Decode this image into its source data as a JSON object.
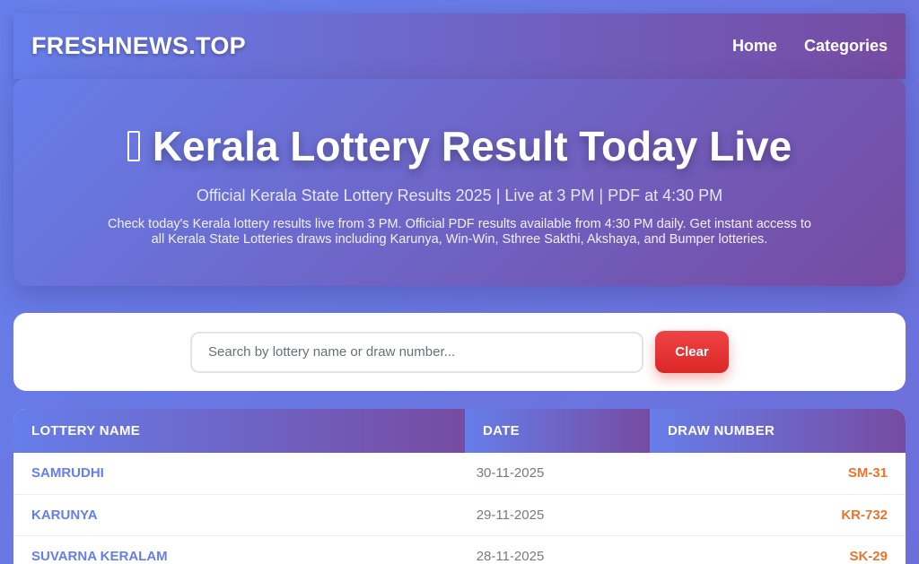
{
  "header": {
    "brand": "FRESHNEWS.TOP",
    "nav": [
      {
        "label": "Home"
      },
      {
        "label": "Categories"
      }
    ]
  },
  "hero": {
    "icon": "box-placeholder-icon",
    "title": "Kerala Lottery Result Today Live",
    "subtitle": "Official Kerala State Lottery Results 2025 | Live at 3 PM | PDF at 4:30 PM",
    "description": "Check today's Kerala lottery results live from 3 PM. Official PDF results available from 4:30 PM daily. Get instant access to all Kerala State Lotteries draws including Karunya, Win-Win, Sthree Sakthi, Akshaya, and Bumper lotteries."
  },
  "search": {
    "placeholder": "Search by lottery name or draw number...",
    "value": "",
    "clear_label": "Clear"
  },
  "table": {
    "columns": [
      "LOTTERY NAME",
      "DATE",
      "DRAW NUMBER"
    ],
    "rows": [
      {
        "name": "SAMRUDHI",
        "date": "30-11-2025",
        "draw": "SM-31"
      },
      {
        "name": "KARUNYA",
        "date": "29-11-2025",
        "draw": "KR-732"
      },
      {
        "name": "SUVARNA KERALAM",
        "date": "28-11-2025",
        "draw": "SK-29"
      }
    ]
  },
  "colors": {
    "gradient_start": "#667eea",
    "gradient_end": "#764ba2",
    "accent_orange": "#e8752e",
    "clear_red": "#dc2626"
  }
}
